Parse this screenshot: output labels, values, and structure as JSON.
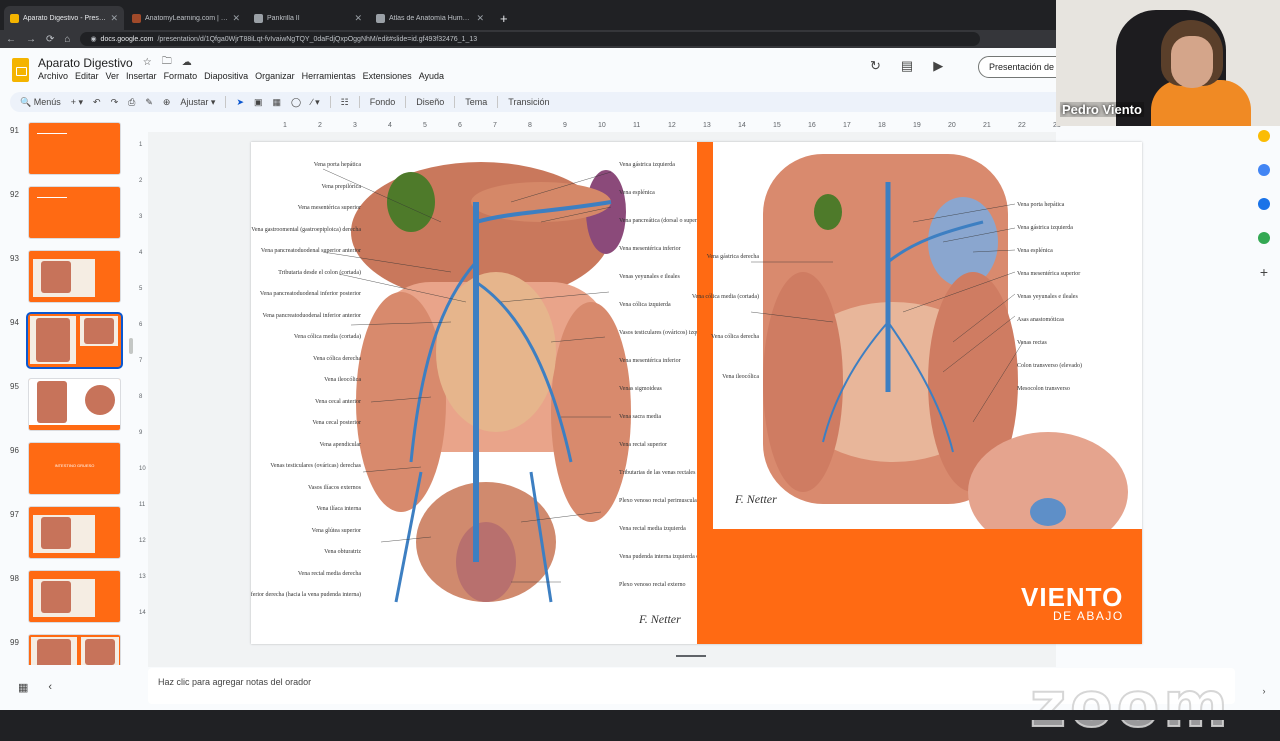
{
  "browser": {
    "tabs": [
      {
        "title": "Aparato Digestivo - Presentación",
        "color": "#f4b400",
        "active": true
      },
      {
        "title": "AnatomyLearning.com | WebGL",
        "color": "#a04a2a",
        "active": false
      },
      {
        "title": "Pankrilla II",
        "color": "#9aa0a6",
        "active": false
      },
      {
        "title": "Atlas de Anatomía Humana Nett",
        "color": "#9aa0a6",
        "active": false
      }
    ],
    "url_host": "docs.google.com",
    "url_path": "/presentation/d/1Qfga0WjrT88iLqt-fvIvaiwNgTQY_0daFdjQxpOggNhM/edit#slide=id.gf493f32476_1_13"
  },
  "app": {
    "doc_title": "Aparato Digestivo",
    "menu": [
      "Archivo",
      "Editar",
      "Ver",
      "Insertar",
      "Formato",
      "Diapositiva",
      "Organizar",
      "Herramientas",
      "Extensiones",
      "Ayuda"
    ],
    "present_label": "Presentación de",
    "toolbar": {
      "search": "Menús",
      "zoom": "Ajustar",
      "fondo": "Fondo",
      "diseno": "Diseño",
      "tema": "Tema",
      "transicion": "Transición"
    },
    "notes_placeholder": "Haz clic para agregar notas del orador"
  },
  "filmstrip": [
    {
      "num": "91",
      "kind": "orange-text"
    },
    {
      "num": "92",
      "kind": "orange-text"
    },
    {
      "num": "93",
      "kind": "figure-one"
    },
    {
      "num": "94",
      "kind": "figure-two",
      "selected": true
    },
    {
      "num": "95",
      "kind": "figure-two-white"
    },
    {
      "num": "96",
      "kind": "title",
      "label": "INTESTINO GRUESO"
    },
    {
      "num": "97",
      "kind": "figure-one"
    },
    {
      "num": "98",
      "kind": "figure-one"
    },
    {
      "num": "99",
      "kind": "figure-two"
    }
  ],
  "ruler": {
    "h": [
      "1",
      "2",
      "3",
      "4",
      "5",
      "6",
      "7",
      "8",
      "9",
      "10",
      "11",
      "12",
      "13",
      "14",
      "15",
      "16",
      "17",
      "18",
      "19",
      "20",
      "21",
      "22",
      "23"
    ],
    "v": [
      "1",
      "2",
      "3",
      "4",
      "5",
      "6",
      "7",
      "8",
      "9",
      "10",
      "11",
      "12",
      "13",
      "14"
    ]
  },
  "slide": {
    "left_labels": [
      "Vena porta hepática",
      "Vena prepilórica",
      "Vena mesentérica superior",
      "Vena gastroomental (gastroepiploica) derecha",
      "Vena pancreatoduodenal superior anterior",
      "Tributaria desde el colon (cortada)",
      "Vena pancreatoduodenal inferior posterior",
      "Vena pancreatoduodenal inferior anterior",
      "Vena cólica media (cortada)",
      "Vena cólica derecha",
      "Vena ileocólica",
      "Vena cecal anterior",
      "Vena cecal posterior",
      "Vena apendicular",
      "Venas testiculares (ováricas) derechas",
      "Vasos ilíacos externos",
      "Vena ilíaca interna",
      "Vena glútea superior",
      "Vena obturatriz",
      "Vena rectal media derecha",
      "Vena rectal inferior derecha (hacia la vena pudenda interna)"
    ],
    "right_labels": [
      "Vena gástrica izquierda",
      "Vena esplénica",
      "Vena pancreática (dorsal o superior)",
      "Vena mesentérica inferior",
      "Venas yeyunales e ileales",
      "Vena cólica izquierda",
      "Vasos testiculares (ováricos) izquierdos",
      "Vena mesentérica inferior",
      "Venas sigmoideas",
      "Vena sacra media",
      "Vena rectal superior",
      "Tributarias de las venas rectales superiores derecha e izquierda",
      "Plexo venoso rectal perimuscular",
      "Vena rectal media izquierda",
      "Vena pudenda interna izquierda en el conducto pudendo (de Alcock)",
      "Plexo venoso rectal externo"
    ],
    "fig2_left_labels": [
      "Vena gástrica derecha",
      "Vena cólica media (cortada)",
      "Vena cólica derecha",
      "Vena ileocólica"
    ],
    "fig2_right_labels": [
      "Vena porta hepática",
      "Vena gástrica izquierda",
      "Vena esplénica",
      "Vena mesentérica superior",
      "Venas yeyunales e ileales",
      "Asas anastomóticas",
      "Venas rectas",
      "Colon transverso (elevado)",
      "Mesocolon transverso"
    ],
    "signature": "F. Netter",
    "brand_main": "VIENTO",
    "brand_sub": "DE ABAJO"
  },
  "webcam": {
    "name": "Pedro Viento"
  },
  "watermark": "zoom",
  "colors": {
    "orange": "#ff6a13",
    "accent": "#0b57d0"
  }
}
